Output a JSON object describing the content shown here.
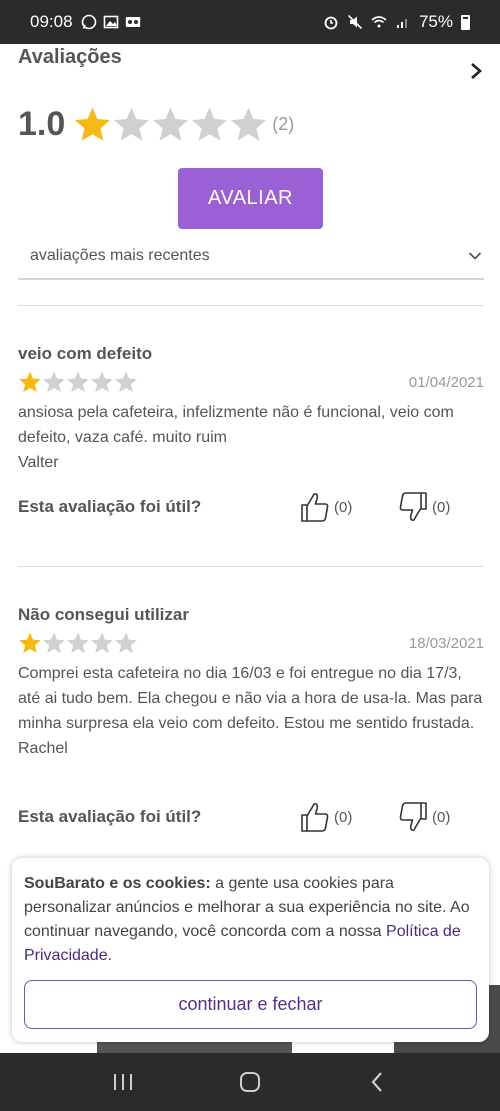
{
  "status_bar": {
    "time": "09:08",
    "battery": "75%"
  },
  "reviews": {
    "title": "Avaliações",
    "rating_value": "1.0",
    "rating_stars": 1,
    "rating_count": "(2)",
    "rate_button_label": "AVALIAR",
    "sort_label": "avaliações mais recentes"
  },
  "review_list": [
    {
      "title": "veio com defeito",
      "stars": 1,
      "date": "01/04/2021",
      "body": "ansiosa pela cafeteira, infelizmente não é funcional, veio com defeito, vaza café. muito ruim",
      "author": "Valter",
      "helpful_label": "Esta avaliação foi útil?",
      "up_count": "(0)",
      "down_count": "(0)"
    },
    {
      "title": "Não consegui utilizar",
      "stars": 1,
      "date": "18/03/2021",
      "body": "Comprei esta cafeteira no dia 16/03 e foi entregue no dia 17/3, até ai tudo bem. Ela chegou e não via a hora de usa-la. Mas para minha surpresa ela veio com defeito. Estou me sentido frustada.",
      "author": "Rachel",
      "helpful_label": "Esta avaliação foi útil?",
      "up_count": "(0)",
      "down_count": "(0)"
    }
  ],
  "cookie_banner": {
    "bold_text": "SouBarato e os cookies:",
    "text": " a gente usa cookies para personalizar anúncios e melhorar a sua experiência no site. Ao continuar navegando, você concorda com a nossa ",
    "link_text": "Política de Privacidade",
    "end_text": ".",
    "button_label": "continuar e fechar"
  },
  "colors": {
    "accent": "#9b5fd6",
    "star_filled": "#f5b914",
    "star_empty": "#d0d0d0"
  },
  "icons": [
    "whatsapp-icon",
    "gallery-icon",
    "voicemail-icon",
    "alarm-icon",
    "mute-icon",
    "wifi-icon",
    "signal-icon",
    "battery-icon",
    "chevron-right-icon",
    "star-icon",
    "chevron-down-icon",
    "thumbs-up-icon",
    "thumbs-down-icon",
    "nav-recents-icon",
    "nav-home-icon",
    "nav-back-icon"
  ]
}
